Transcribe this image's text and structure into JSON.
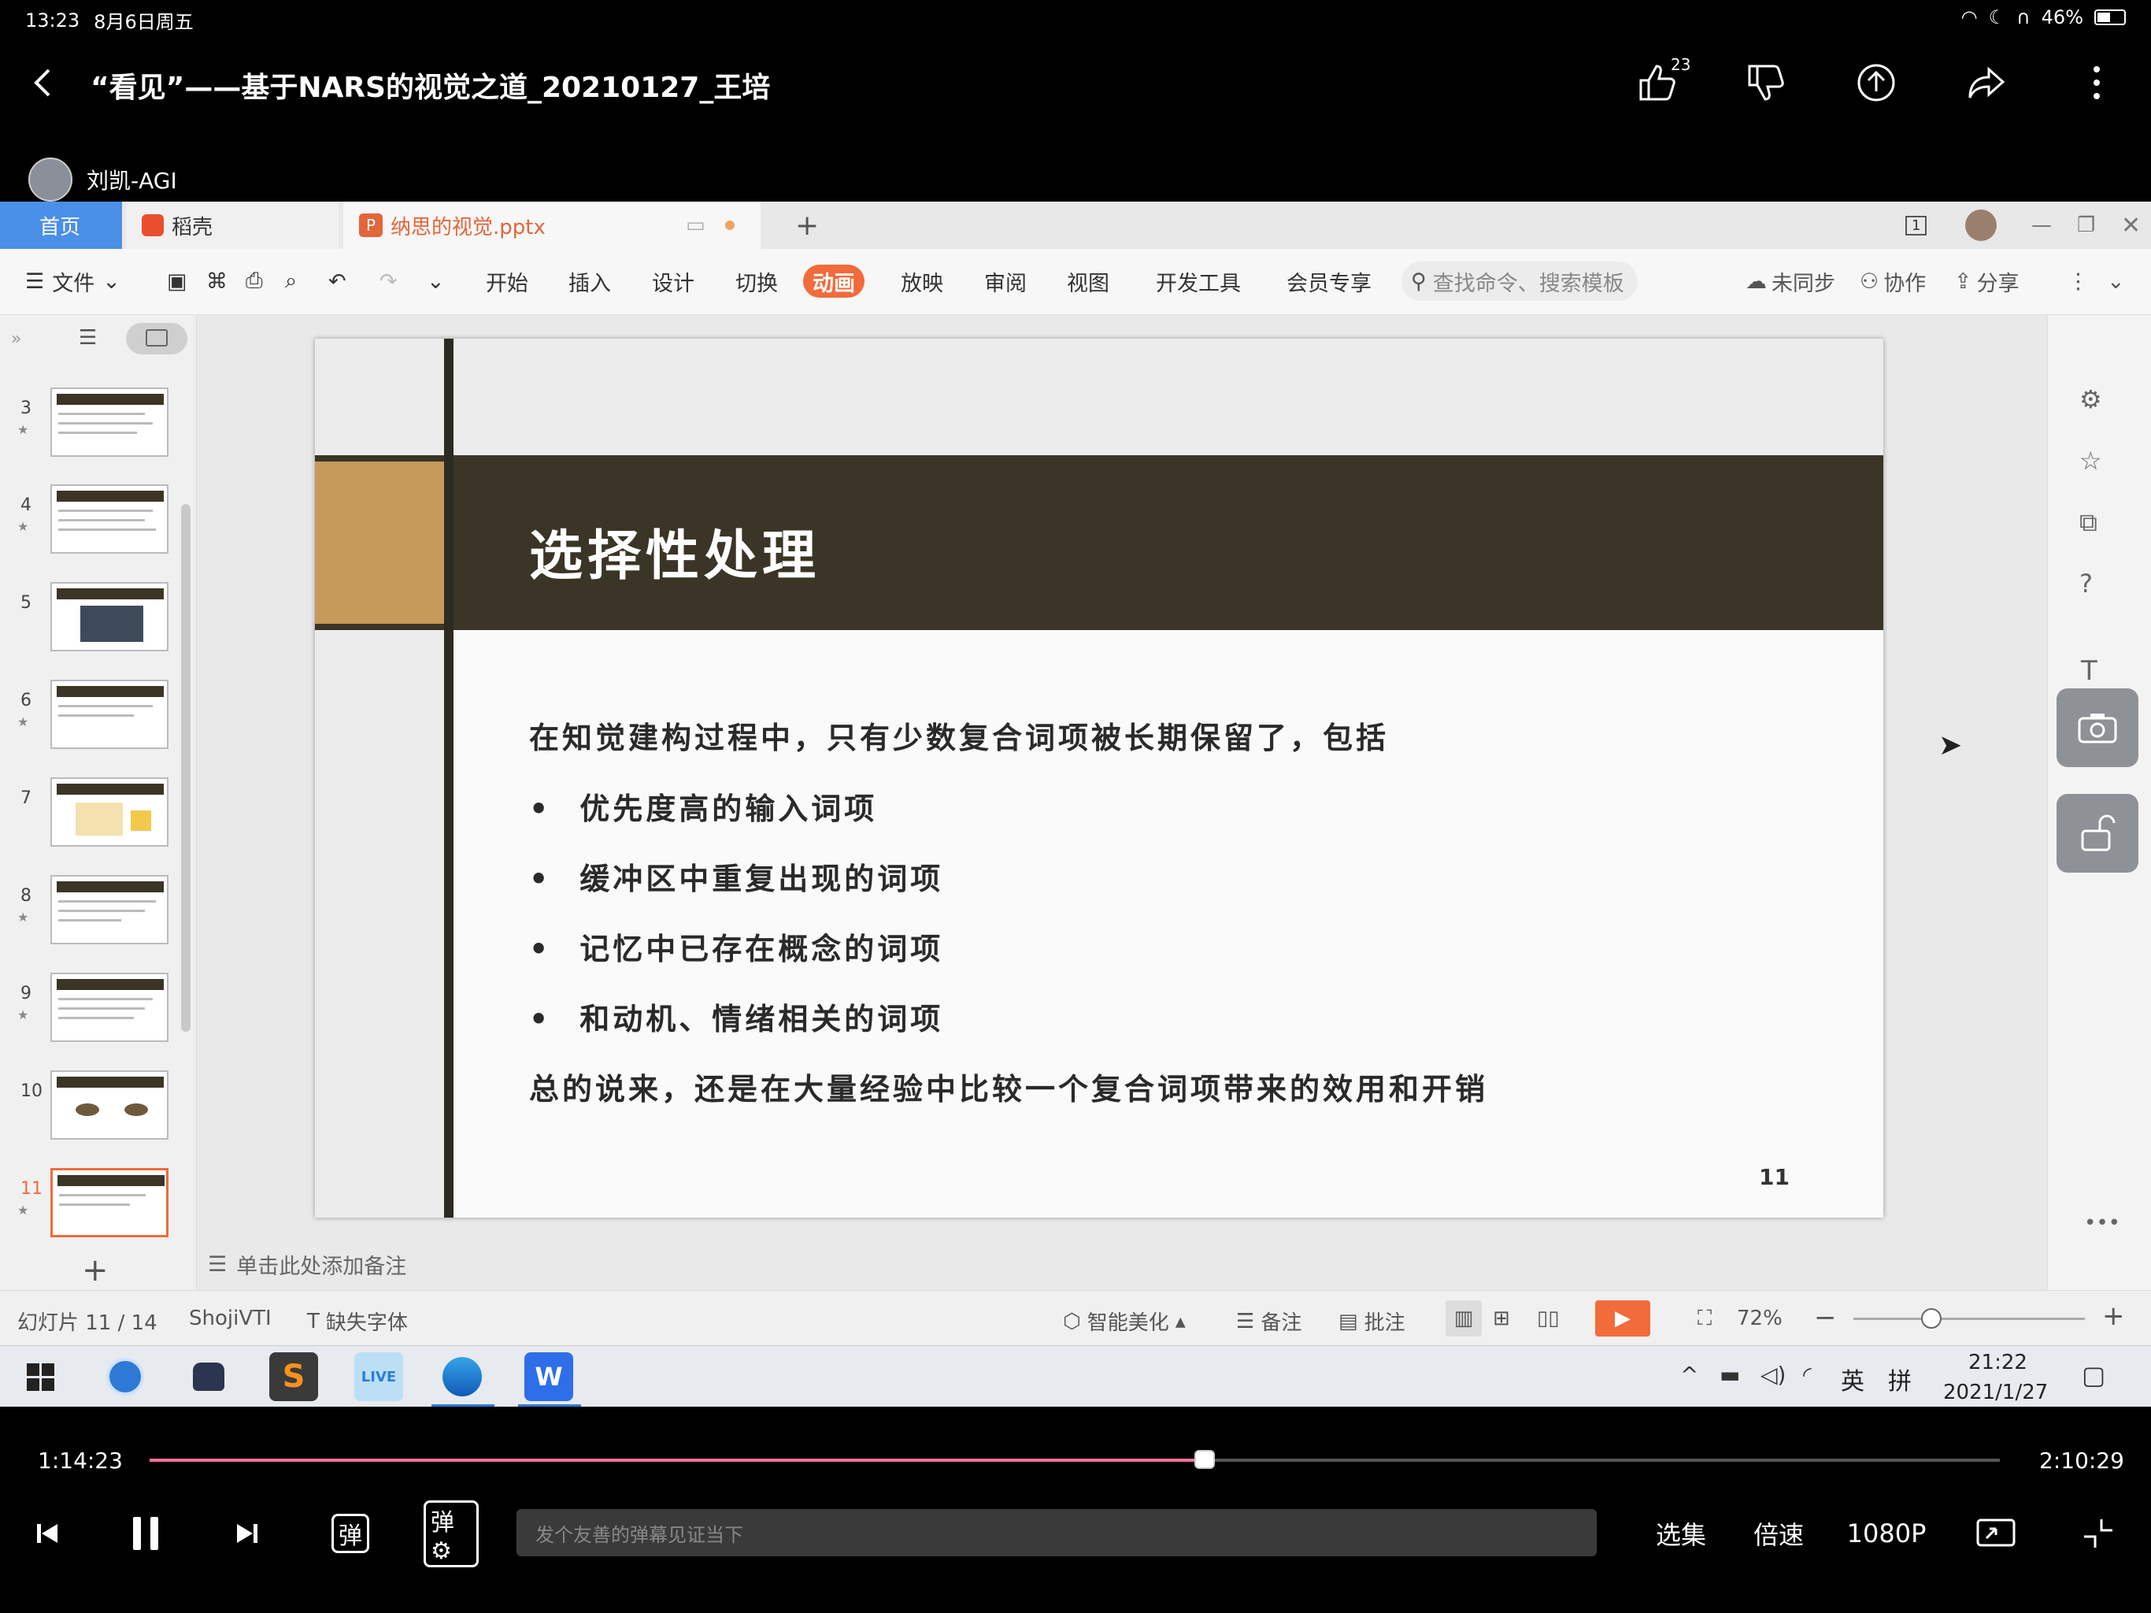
{
  "status_bar": {
    "time": "13:23",
    "date": "8月6日周五",
    "battery": "46%"
  },
  "video": {
    "title": "“看见”——基于NARS的视觉之道_20210127_王培",
    "like_count": "23",
    "uploader": "刘凯-AGI",
    "current_time": "1:14:23",
    "total_time": "2:10:29",
    "progress": 0.57,
    "danmu_placeholder": "发个友善的弹幕见证当下",
    "episodes_label": "选集",
    "speed_label": "倍速",
    "quality_label": "1080P"
  },
  "wps": {
    "tabs": {
      "home": "首页",
      "daoke": "稻壳",
      "file": "纳思的视觉.pptx"
    },
    "menu": {
      "file": "文件",
      "items": [
        "开始",
        "插入",
        "设计",
        "切换",
        "动画",
        "放映",
        "审阅",
        "视图",
        "开发工具",
        "会员专享"
      ],
      "active": "动画",
      "search_placeholder": "查找命令、搜索模板",
      "unsynced": "未同步",
      "collab": "协作",
      "share": "分享"
    },
    "thumb_numbers": [
      "3",
      "4",
      "5",
      "6",
      "7",
      "8",
      "9",
      "10",
      "11"
    ],
    "add_notes": "单击此处添加备注",
    "status": {
      "slide_count": "幻灯片 11 / 14",
      "theme": "ShojiVTI",
      "missing_font": "缺失字体",
      "beautify": "智能美化",
      "notes": "备注",
      "comments": "批注",
      "zoom": "72%"
    },
    "slide": {
      "title": "选择性处理",
      "intro": "在知觉建构过程中，只有少数复合词项被长期保留了，包括",
      "bullets": [
        "优先度高的输入词项",
        "缓冲区中重复出现的词项",
        "记忆中已存在概念的词项",
        "和动机、情绪相关的词项"
      ],
      "summary": "总的说来，还是在大量经验中比较一个复合词项带来的效用和开销",
      "page_number": "11"
    }
  },
  "taskbar": {
    "ime_lang": "英",
    "ime_mode": "拼",
    "time": "21:22",
    "date": "2021/1/27"
  },
  "colors": {
    "accent_orange": "#f26b3a",
    "slide_header": "#3a3526",
    "slide_gold": "#c59a5a",
    "progress_pink": "#fb7299",
    "tab_blue": "#4a8fe8"
  }
}
